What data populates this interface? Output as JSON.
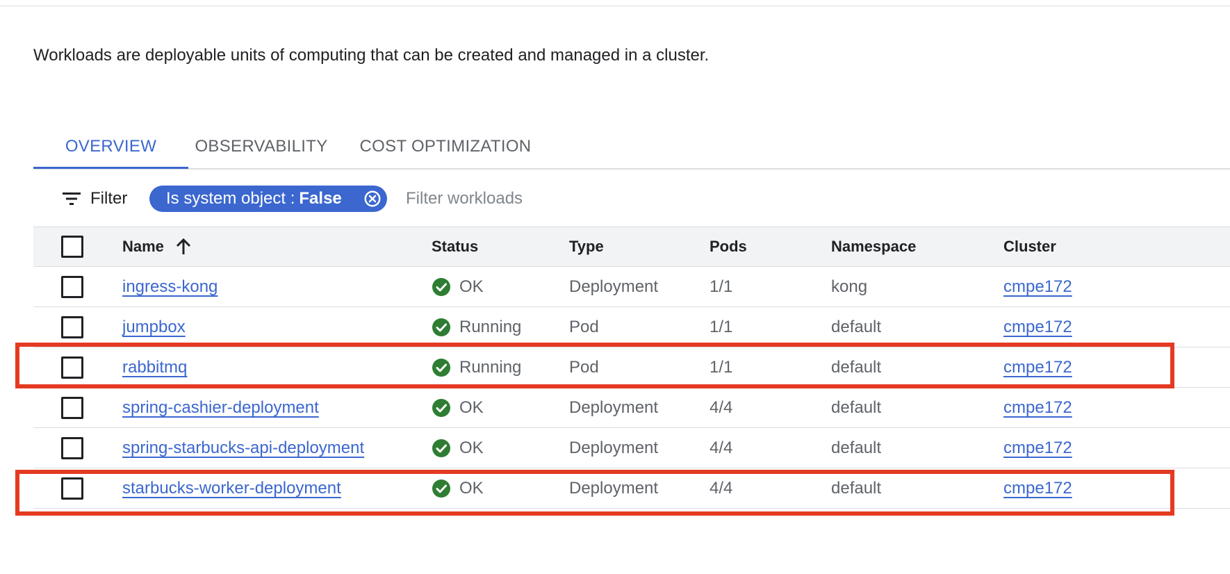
{
  "description": "Workloads are deployable units of computing that can be created and managed in a cluster.",
  "tabs": [
    {
      "label": "OVERVIEW",
      "active": true
    },
    {
      "label": "OBSERVABILITY",
      "active": false
    },
    {
      "label": "COST OPTIMIZATION",
      "active": false
    }
  ],
  "filter": {
    "label": "Filter",
    "chip_key": "Is system object : ",
    "chip_value": "False",
    "placeholder": "Filter workloads"
  },
  "table": {
    "headers": {
      "name": "Name",
      "status": "Status",
      "type": "Type",
      "pods": "Pods",
      "namespace": "Namespace",
      "cluster": "Cluster"
    },
    "rows": [
      {
        "name": "ingress-kong",
        "status": "OK",
        "type": "Deployment",
        "pods": "1/1",
        "namespace": "kong",
        "cluster": "cmpe172"
      },
      {
        "name": "jumpbox",
        "status": "Running",
        "type": "Pod",
        "pods": "1/1",
        "namespace": "default",
        "cluster": "cmpe172"
      },
      {
        "name": "rabbitmq",
        "status": "Running",
        "type": "Pod",
        "pods": "1/1",
        "namespace": "default",
        "cluster": "cmpe172"
      },
      {
        "name": "spring-cashier-deployment",
        "status": "OK",
        "type": "Deployment",
        "pods": "4/4",
        "namespace": "default",
        "cluster": "cmpe172"
      },
      {
        "name": "spring-starbucks-api-deployment",
        "status": "OK",
        "type": "Deployment",
        "pods": "4/4",
        "namespace": "default",
        "cluster": "cmpe172"
      },
      {
        "name": "starbucks-worker-deployment",
        "status": "OK",
        "type": "Deployment",
        "pods": "4/4",
        "namespace": "default",
        "cluster": "cmpe172"
      }
    ]
  },
  "colors": {
    "accent": "#3b67cf",
    "status_ok": "#2e7d32",
    "highlight": "#e53a22"
  },
  "icons": {
    "filter": "filter-lines-icon",
    "chip_close": "close-circle-icon",
    "sort": "arrow-up-icon",
    "status": "check-circle-icon"
  }
}
